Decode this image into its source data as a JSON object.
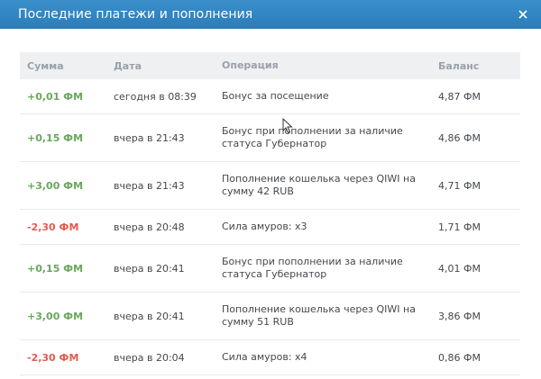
{
  "dialog": {
    "title": "Последние платежи и пополнения",
    "close_glyph": "×"
  },
  "table": {
    "columns": [
      "Сумма",
      "Дата",
      "Операция",
      "Баланс"
    ],
    "rows": [
      {
        "amount": "+0,01 ФМ",
        "date": "сегодня в 08:39",
        "operation_line1": "Бонус за посещение",
        "operation_line2": "",
        "balance": "4,87 ФМ",
        "sign": "plus"
      },
      {
        "amount": "+0,15 ФМ",
        "date": "вчера в 21:43",
        "operation_line1": "Бонус при пополнении за наличие",
        "operation_line2": "статуса Губернатор",
        "balance": "4,86 ФМ",
        "sign": "plus"
      },
      {
        "amount": "+3,00 ФМ",
        "date": "вчера в 21:43",
        "operation_line1": "Пополнение кошелька через QIWI на",
        "operation_line2": "сумму 42 RUB",
        "balance": "4,71 ФМ",
        "sign": "plus"
      },
      {
        "amount": "-2,30 ФМ",
        "date": "вчера в 20:48",
        "operation_line1": "Сила амуров: x3",
        "operation_line2": "",
        "balance": "1,71 ФМ",
        "sign": "minus"
      },
      {
        "amount": "+0,15 ФМ",
        "date": "вчера в 20:41",
        "operation_line1": "Бонус при пополнении за наличие",
        "operation_line2": "статуса Губернатор",
        "balance": "4,01 ФМ",
        "sign": "plus"
      },
      {
        "amount": "+3,00 ФМ",
        "date": "вчера в 20:41",
        "operation_line1": "Пополнение кошелька через QIWI на",
        "operation_line2": "сумму 51 RUB",
        "balance": "3,86 ФМ",
        "sign": "plus"
      },
      {
        "amount": "-2,30 ФМ",
        "date": "вчера в 20:04",
        "operation_line1": "Сила амуров: x4",
        "operation_line2": "",
        "balance": "0,86 ФМ",
        "sign": "minus"
      }
    ]
  },
  "colors": {
    "header": "#2e86c1",
    "plus": "#6aa75b",
    "minus": "#e35a4f"
  }
}
